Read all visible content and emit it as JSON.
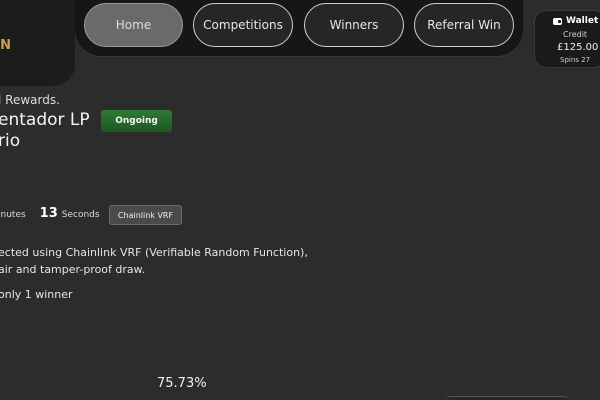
{
  "logo": {
    "text": "WIN"
  },
  "nav": {
    "items": [
      {
        "label": "Home"
      },
      {
        "label": "Competitions"
      },
      {
        "label": "Winners"
      },
      {
        "label": "Referral Win"
      }
    ]
  },
  "wallet": {
    "title": "Wallet",
    "icon": "wallet-icon",
    "credit_label": "Credit",
    "amount": "£125.00",
    "spins": "Spins 27"
  },
  "competition": {
    "rewards_text": "l Rewards.",
    "title_line1": "entador LP",
    "title_line2": "rio",
    "status": "Ongoing",
    "status_color": "#2f7a34"
  },
  "timer": {
    "minutes_label": "inutes",
    "seconds_value": "13",
    "seconds_label": "Seconds"
  },
  "vrf_button": {
    "label": "Chainlink VRF"
  },
  "description": {
    "line1": "ected using Chainlink VRF (Verifiable Random Function),",
    "line2": "air and tamper-proof draw."
  },
  "winners_note": "only 1 winner",
  "progress": {
    "label": "75.73%",
    "value": 75.73
  }
}
